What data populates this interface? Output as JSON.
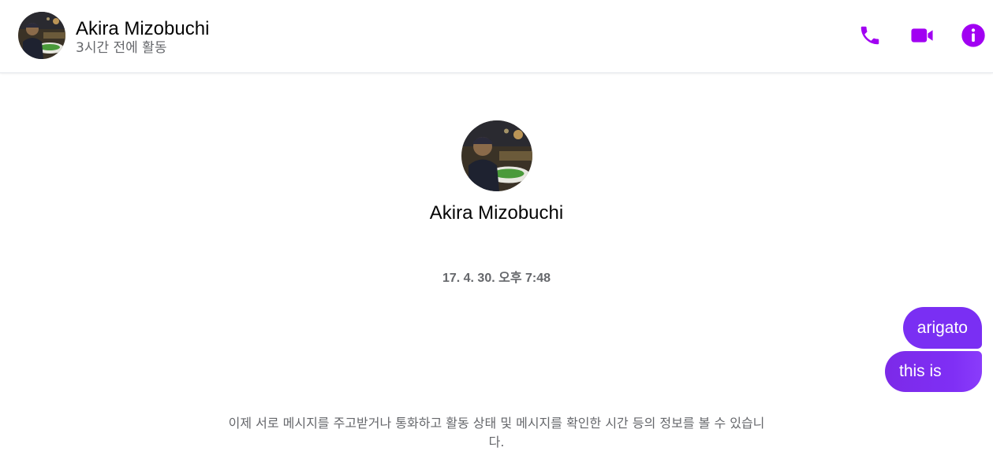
{
  "header": {
    "name": "Akira Mizobuchi",
    "status": "3시간 전에 활동"
  },
  "icons": {
    "call": "phone-icon",
    "video": "video-camera-icon",
    "info": "info-icon"
  },
  "accent_color": "#a100f2",
  "bubble_color": "#7b2ff7",
  "profile": {
    "name": "Akira Mizobuchi"
  },
  "conversation": {
    "timestamp": "17. 4. 30. 오후 7:48",
    "messages": [
      {
        "text": "arigato",
        "sender": "me"
      },
      {
        "text": "this is",
        "sender": "me"
      }
    ]
  },
  "notice": "이제 서로 메시지를 주고받거나 통화하고 활동 상태 및 메시지를 확인한 시간 등의 정보를 볼 수 있습니다."
}
